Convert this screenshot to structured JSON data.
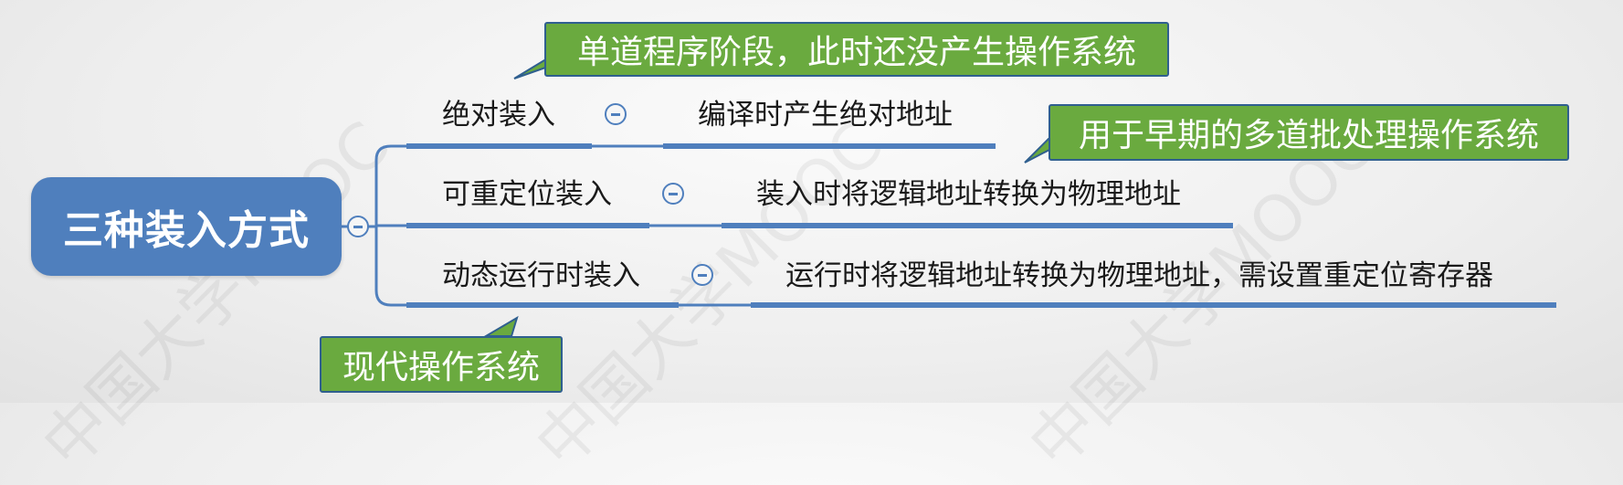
{
  "mindmap": {
    "root": "三种装入方式",
    "branches": [
      {
        "name": "绝对装入",
        "detail": "编译时产生绝对地址"
      },
      {
        "name": "可重定位装入",
        "detail": "装入时将逻辑地址转换为物理地址"
      },
      {
        "name": "动态运行时装入",
        "detail": "运行时将逻辑地址转换为物理地址，需设置重定位寄存器"
      }
    ]
  },
  "callouts": {
    "single_program": "单道程序阶段，此时还没产生操作系统",
    "batch": "用于早期的多道批处理操作系统",
    "modern": "现代操作系统"
  },
  "watermark": "中国大学MOOC",
  "colors": {
    "node_blue": "#4f7fbd",
    "callout_green": "#6aaa3f",
    "callout_border": "#2f5f8f"
  }
}
